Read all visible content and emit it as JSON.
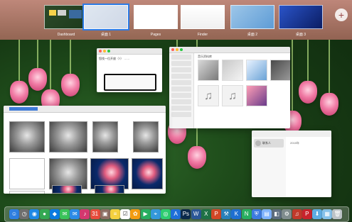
{
  "spaces": {
    "items": [
      {
        "label": "Dashboard"
      },
      {
        "label": "桌面 1"
      },
      {
        "label": "Pages"
      },
      {
        "label": "Finder"
      },
      {
        "label": "桌面 2"
      },
      {
        "label": "桌面 3"
      }
    ],
    "add_label": "+"
  },
  "windows": {
    "pages": {
      "text": "您找一位开放（?）\n……"
    },
    "music": {
      "heading": "音乐资料库"
    },
    "messages": {
      "contact": "联系人",
      "meta": "2015年"
    }
  },
  "dock": {
    "icons": [
      {
        "name": "finder-icon",
        "color": "#2f7fe0",
        "glyph": "☺"
      },
      {
        "name": "launchpad-icon",
        "color": "#6e6e6e",
        "glyph": "◷"
      },
      {
        "name": "safari-icon",
        "color": "#1e88e5",
        "glyph": "◉"
      },
      {
        "name": "chrome-icon",
        "color": "#34a853",
        "glyph": "●"
      },
      {
        "name": "qq-icon",
        "color": "#0b7be0",
        "glyph": "◆"
      },
      {
        "name": "messages-icon",
        "color": "#39c35a",
        "glyph": "✉"
      },
      {
        "name": "mail-icon",
        "color": "#2b8be6",
        "glyph": "✉"
      },
      {
        "name": "itunes-icon",
        "color": "#d3386f",
        "glyph": "♪"
      },
      {
        "name": "calendar-icon",
        "color": "#e74c3c",
        "glyph": "31"
      },
      {
        "name": "contacts-icon",
        "color": "#8d6e63",
        "glyph": "▣"
      },
      {
        "name": "notes-icon",
        "color": "#f4d03f",
        "glyph": "≡"
      },
      {
        "name": "reminders-icon",
        "color": "#ffffff",
        "glyph": "☑"
      },
      {
        "name": "photos-icon",
        "color": "#f39c12",
        "glyph": "✿"
      },
      {
        "name": "facetime-icon",
        "color": "#27ae60",
        "glyph": "▶"
      },
      {
        "name": "maps-icon",
        "color": "#3498db",
        "glyph": "⌖"
      },
      {
        "name": "wechat-icon",
        "color": "#2ecc71",
        "glyph": "◎"
      },
      {
        "name": "app-store-icon",
        "color": "#1e6fd9",
        "glyph": "A"
      },
      {
        "name": "photoshop-icon",
        "color": "#0b2a4a",
        "glyph": "Ps"
      },
      {
        "name": "word-icon",
        "color": "#2b5797",
        "glyph": "W"
      },
      {
        "name": "excel-icon",
        "color": "#1e7145",
        "glyph": "X"
      },
      {
        "name": "powerpoint-icon",
        "color": "#d24726",
        "glyph": "P"
      },
      {
        "name": "xcode-icon",
        "color": "#2980b9",
        "glyph": "⚒"
      },
      {
        "name": "keynote-icon",
        "color": "#1f6fd1",
        "glyph": "K"
      },
      {
        "name": "numbers-icon",
        "color": "#27ae60",
        "glyph": "N"
      },
      {
        "name": "security-icon",
        "color": "#3d7be0",
        "glyph": "⛨"
      },
      {
        "name": "folder-icon",
        "color": "#7fb3ff",
        "glyph": "▤"
      },
      {
        "name": "preview-icon",
        "color": "#5d6d7e",
        "glyph": "◧"
      },
      {
        "name": "system-preferences-icon",
        "color": "#7f8c8d",
        "glyph": "⚙"
      },
      {
        "name": "music-app-icon",
        "color": "#c0392b",
        "glyph": "♫"
      },
      {
        "name": "pinterest-icon",
        "color": "#c8232c",
        "glyph": "P"
      },
      {
        "name": "downloads-icon",
        "color": "#5dade2",
        "glyph": "⬇"
      },
      {
        "name": "documents-icon",
        "color": "#85c1e9",
        "glyph": "▦"
      },
      {
        "name": "trash-icon",
        "color": "#bdc3c7",
        "glyph": "🗑"
      }
    ]
  }
}
